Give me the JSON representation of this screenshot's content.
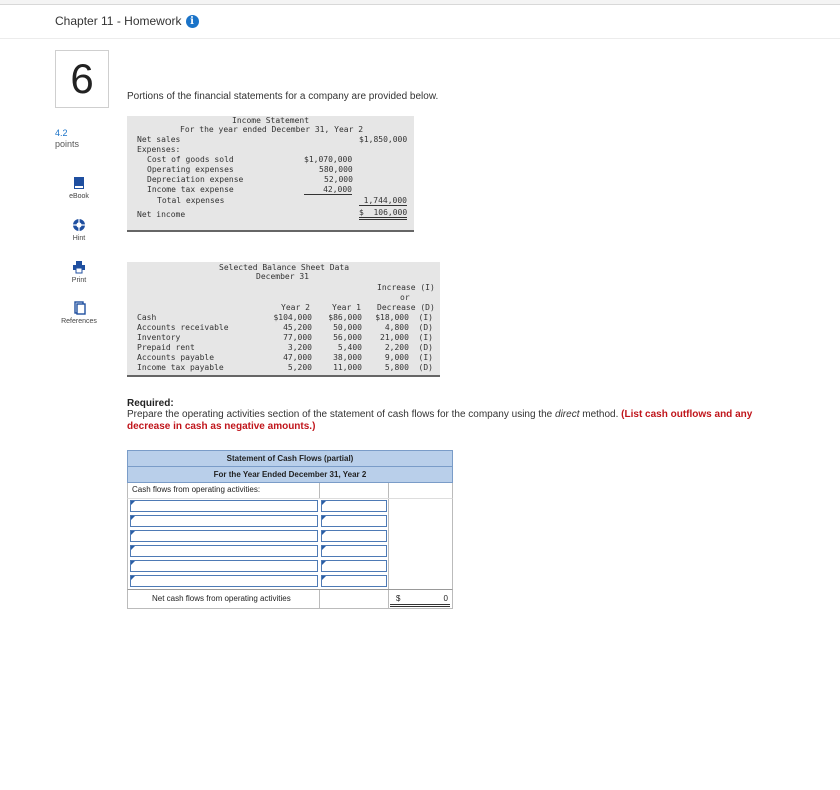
{
  "header": {
    "title": "Chapter 11 - Homework",
    "info_glyph": "i"
  },
  "question": {
    "number": "6",
    "points_value": "4.2",
    "points_label": "points"
  },
  "sidebar": [
    {
      "label": "eBook",
      "icon": "book-icon"
    },
    {
      "label": "Hint",
      "icon": "lifebuoy-icon"
    },
    {
      "label": "Print",
      "icon": "printer-icon"
    },
    {
      "label": "References",
      "icon": "document-icon"
    }
  ],
  "prompt": "Portions of the financial statements for a company are provided below.",
  "income_statement": {
    "title": "Income Statement",
    "subtitle": "For the year ended December 31, Year 2",
    "net_sales_label": "Net sales",
    "net_sales": "$1,850,000",
    "expenses_label": "Expenses:",
    "expenses": [
      {
        "label": "Cost of goods sold",
        "amount": "$1,070,000"
      },
      {
        "label": "Operating expenses",
        "amount": "580,000"
      },
      {
        "label": "Depreciation expense",
        "amount": "52,000"
      },
      {
        "label": "Income tax expense",
        "amount": "42,000"
      }
    ],
    "total_label": "Total expenses",
    "total": "1,744,000",
    "net_income_label": "Net income",
    "net_income": "$  106,000"
  },
  "balance_sheet": {
    "title": "Selected Balance Sheet Data",
    "subtitle": "December 31",
    "col_change_1": "Increase (I)",
    "col_change_2": "or",
    "col_year2": "Year 2",
    "col_year1": "Year 1",
    "col_change_3": "Decrease (D)",
    "rows": [
      {
        "label": "Cash",
        "year2": "$104,000",
        "year1": "$86,000",
        "change": "$18,000  (I)"
      },
      {
        "label": "Accounts receivable",
        "year2": "45,200",
        "year1": "50,000",
        "change": "4,800  (D)"
      },
      {
        "label": "Inventory",
        "year2": "77,000",
        "year1": "56,000",
        "change": "21,000  (I)"
      },
      {
        "label": "Prepaid rent",
        "year2": "3,200",
        "year1": "5,400",
        "change": "2,200  (D)"
      },
      {
        "label": "Accounts payable",
        "year2": "47,000",
        "year1": "38,000",
        "change": "9,000  (I)"
      },
      {
        "label": "Income tax payable",
        "year2": "5,200",
        "year1": "11,000",
        "change": "5,800  (D)"
      }
    ]
  },
  "required": {
    "title": "Required:",
    "text_a": "Prepare the operating activities section of the statement of cash flows for the company using the ",
    "text_italic": "direct",
    "text_b": " method. ",
    "text_red": "(List cash outflows and any decrease in cash as negative amounts.)"
  },
  "cash_flow_form": {
    "title": "Statement of Cash Flows (partial)",
    "subtitle": "For the Year Ended December 31, Year 2",
    "section_label": "Cash flows from operating activities:",
    "input_rows": 6,
    "total_label": "Net cash flows from operating activities",
    "total_currency": "$",
    "total_value": "0"
  }
}
